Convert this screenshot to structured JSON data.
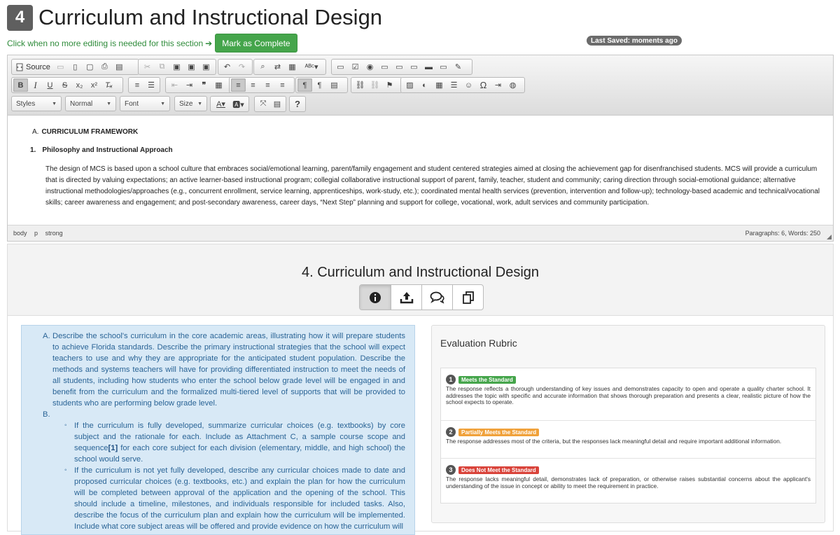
{
  "header": {
    "section_number": "4",
    "title": "Curriculum and Instructional Design"
  },
  "completion": {
    "instruction": "Click when no more editing is needed for this section",
    "button_label": "Mark as Complete"
  },
  "last_saved": "Last Saved: moments ago",
  "editor": {
    "toolbar": {
      "source_label": "Source",
      "combos": {
        "styles": "Styles",
        "format": "Normal",
        "font": "Font",
        "size": "Size"
      },
      "help_label": "?"
    },
    "content": {
      "heading1_prefix": "A.",
      "heading1": "CURRICULUM FRAMEWORK",
      "heading2_prefix": "1.",
      "heading2": "Philosophy and Instructional Approach",
      "paragraph": "The design of MCS is based upon a school culture that embraces social/emotional learning, parent/family engagement and student centered strategies aimed at closing the achievement gap for disenfranchised students.  MCS will provide a curriculum that is directed by valuing expectations; an active learner-based instructional program; collegial collaborative instructional support of parent, family, teacher, student and community; caring direction through social-emotional guidance; alternative instructional methodologies/approaches (e.g., concurrent enrollment, service learning, apprenticeships, work-study, etc.); coordinated mental health services (prevention, intervention and follow-up); technology-based academic and technical/vocational skills; career awareness and engagement; and post-secondary awareness, career days, “Next Step” planning and support for college, vocational, work, adult services and community participation."
    },
    "status": {
      "path": [
        "body",
        "p",
        "strong"
      ],
      "counts": "Paragraphs: 6, Words: 250"
    }
  },
  "section": {
    "title": "4. Curriculum and Instructional Design",
    "tabs": [
      "info-icon",
      "upload-icon",
      "comments-icon",
      "copy-icon"
    ],
    "prompt": {
      "a_mark": "A.",
      "a_text": "Describe the school's curriculum in the core academic areas, illustrating how it will prepare students to achieve Florida standards. Describe the primary instructional strategies that the school will expect teachers to use and why they are appropriate for the anticipated student population. Describe the methods and systems teachers will have for providing differentiated instruction to meet the needs of all students, including how students who enter the school below grade level will be engaged in and benefit from the curriculum and the formalized multi-tiered level of supports that will be provided to students who are performing below grade level.",
      "b_mark": "B.",
      "item1_before": "If the curriculum is fully developed, summarize curricular choices (e.g. textbooks) by core subject and the rationale for each.  Include as Attachment C, a sample course scope and sequence",
      "item1_link": "[1]",
      "item1_after": " for each core subject for each division (elementary, middle, and high school) the school would serve.",
      "item2": "If the curriculum is not yet fully developed, describe any curricular choices made to date and proposed curricular choices (e.g. textbooks, etc.) and explain the plan for how the curriculum will be completed between approval of the application and the opening of the school.  This should include a timeline, milestones, and individuals responsible for included tasks. Also, describe the focus of the curriculum plan and explain how the curriculum will be implemented. Include what core subject areas will be offered and provide evidence on how the curriculum will"
    },
    "rubric": {
      "title": "Evaluation Rubric",
      "items": [
        {
          "number": "1",
          "label": "Meets the Standard",
          "color": "#45a54b",
          "text": "The response reflects a thorough understanding of key issues and demonstrates capacity to open and operate a quality charter school. It addresses the topic with specific and accurate information that shows thorough preparation and presents a clear, realistic picture of how the school expects to operate."
        },
        {
          "number": "2",
          "label": "Partially Meets the Standard",
          "color": "#f0a13a",
          "text": "The response addresses most of the criteria, but the responses lack meaningful detail and require important additional information."
        },
        {
          "number": "3",
          "label": "Does Not Meet the Standard",
          "color": "#d9433a",
          "text": "The response lacks meaningful detail, demonstrates lack of preparation, or otherwise raises substantial concerns about the applicant's understanding of the issue in concept or ability to meet the requirement in practice."
        }
      ]
    }
  }
}
